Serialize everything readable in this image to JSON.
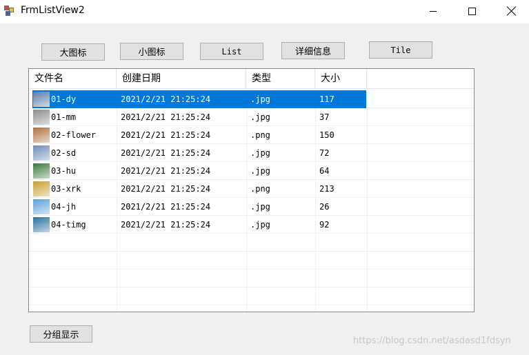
{
  "window": {
    "title": "FrmListView2"
  },
  "toolbar": {
    "large_icon": "大图标",
    "small_icon": "小图标",
    "list": "List",
    "details": "详细信息",
    "tile": "Tile"
  },
  "listview": {
    "columns": [
      "文件名",
      "创建日期",
      "类型",
      "大小"
    ],
    "rows": [
      {
        "name": "01-dy",
        "date": "2021/2/21 21:25:24",
        "type": ".jpg",
        "size": "117",
        "thumb": "#5a7ea8",
        "selected": true
      },
      {
        "name": "01-mm",
        "date": "2021/2/21 21:25:24",
        "type": ".jpg",
        "size": "37",
        "thumb": "#8c8c8c"
      },
      {
        "name": "02-flower",
        "date": "2021/2/21 21:25:24",
        "type": ".png",
        "size": "150",
        "thumb": "#b07040"
      },
      {
        "name": "02-sd",
        "date": "2021/2/21 21:25:24",
        "type": ".jpg",
        "size": "72",
        "thumb": "#6a8cb8"
      },
      {
        "name": "03-hu",
        "date": "2021/2/21 21:25:24",
        "type": ".jpg",
        "size": "64",
        "thumb": "#3c7a3c"
      },
      {
        "name": "03-xrk",
        "date": "2021/2/21 21:25:24",
        "type": ".png",
        "size": "213",
        "thumb": "#c8a030"
      },
      {
        "name": "04-jh",
        "date": "2021/2/21 21:25:24",
        "type": ".jpg",
        "size": "26",
        "thumb": "#5aa0d8"
      },
      {
        "name": "04-timg",
        "date": "2021/2/21 21:25:24",
        "type": ".jpg",
        "size": "92",
        "thumb": "#2a70a0"
      }
    ]
  },
  "footer": {
    "group_button": "分组显示"
  },
  "watermark": "https://blog.csdn.net/asdasd1fdsyn"
}
